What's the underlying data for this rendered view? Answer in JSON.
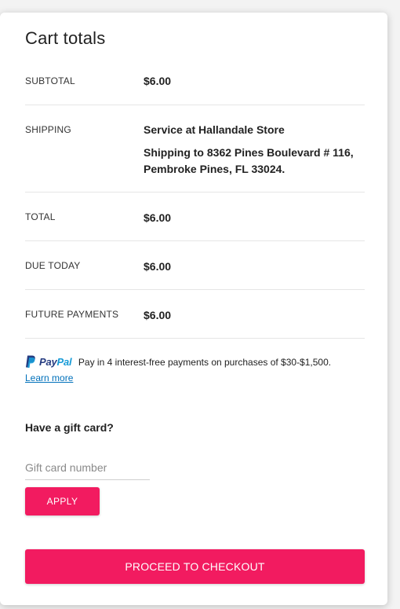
{
  "cart_totals": {
    "title": "Cart totals",
    "subtotal": {
      "label": "SUBTOTAL",
      "value": "$6.00"
    },
    "shipping": {
      "label": "SHIPPING",
      "method": "Service at Hallandale Store",
      "address": "Shipping to 8362 Pines Boulevard # 116, Pembroke Pines, FL 33024."
    },
    "total": {
      "label": "TOTAL",
      "value": "$6.00"
    },
    "due_today": {
      "label": "DUE TODAY",
      "value": "$6.00"
    },
    "future_payments": {
      "label": "FUTURE PAYMENTS",
      "value": "$6.00"
    }
  },
  "paypal": {
    "brand_pay": "Pay",
    "brand_pal": "Pal",
    "message": "Pay in 4 interest-free payments on purchases of $30-$1,500.",
    "learn_more": "Learn more",
    "icon": "paypal-icon"
  },
  "gift_card": {
    "heading": "Have a gift card?",
    "input_value": "",
    "placeholder": "Gift card number",
    "apply_label": "APPLY"
  },
  "checkout": {
    "label": "PROCEED TO CHECKOUT"
  },
  "colors": {
    "accent": "#f21b60",
    "paypal_dark": "#253b80",
    "paypal_light": "#179bd7",
    "link": "#0070ba"
  }
}
